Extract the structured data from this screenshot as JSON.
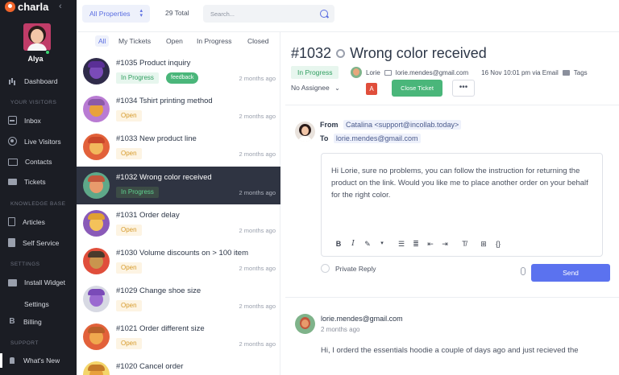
{
  "app": {
    "brand": "charla",
    "user_name": "Alya"
  },
  "sidebar": {
    "items": [
      {
        "label": "Dashboard",
        "icon": "bar-chart-icon"
      },
      {
        "label": "Inbox",
        "icon": "inbox-icon"
      },
      {
        "label": "Live Visitors",
        "icon": "live-visitors-icon"
      },
      {
        "label": "Contacts",
        "icon": "contacts-icon"
      },
      {
        "label": "Tickets",
        "icon": "ticket-icon"
      },
      {
        "label": "Articles",
        "icon": "article-icon"
      },
      {
        "label": "Self Service",
        "icon": "book-icon"
      },
      {
        "label": "Install Widget",
        "icon": "widget-icon"
      },
      {
        "label": "Settings",
        "icon": "settings-icon"
      },
      {
        "label": "Billing",
        "icon": "billing-icon"
      },
      {
        "label": "What's New",
        "icon": "megaphone-icon"
      }
    ],
    "sections": [
      "YOUR VISITORS",
      "KNOWLEDGE BASE",
      "SETTINGS",
      "SUPPORT"
    ]
  },
  "topbar": {
    "property_select": "All Properties",
    "total": "29 Total",
    "search_placeholder": "Search..."
  },
  "filters": [
    "All",
    "My Tickets",
    "Open",
    "In Progress",
    "Closed"
  ],
  "tickets": [
    {
      "title": "#1035 Product inquiry",
      "status": "In Progress",
      "tag": "feedback",
      "time": "2 months ago"
    },
    {
      "title": "#1034 Tshirt printing method",
      "status": "Open",
      "time": "2 months ago"
    },
    {
      "title": "#1033 New product line",
      "status": "Open",
      "time": "2 months ago"
    },
    {
      "title": "#1032 Wrong color received",
      "status": "In Progress",
      "time": "2 months ago"
    },
    {
      "title": "#1031 Order delay",
      "status": "Open",
      "time": "2 months ago"
    },
    {
      "title": "#1030 Volume discounts on > 100 item",
      "status": "Open",
      "time": "2 months ago"
    },
    {
      "title": "#1029 Change shoe size",
      "status": "Open",
      "time": "2 months ago"
    },
    {
      "title": "#1021 Order different size",
      "status": "Open",
      "time": "2 months ago"
    },
    {
      "title": "#1020 Cancel order",
      "status": "",
      "time": ""
    }
  ],
  "detail": {
    "number": "#1032",
    "title": "Wrong color received",
    "status": "In Progress",
    "contact_name": "Lorie",
    "contact_email": "lorie.mendes@gmail.com",
    "received": "16 Nov 10:01 pm via Email",
    "tags_label": "Tags",
    "assignee": "No Assignee",
    "assignee_badge": "A",
    "close_button": "Close Ticket",
    "more_button": "•••",
    "from_label": "From",
    "from_value": "Catalina <support@incollab.today>",
    "to_label": "To",
    "to_value": "lorie.mendes@gmail.com",
    "reply_text": "Hi Lorie, sure no problems, you can follow the instruction for returning the product on the link. Would you like me to place another order on your behalf for the right color.",
    "private_reply": "Private Reply",
    "send_button": "Send",
    "message_from": "lorie.mendes@gmail.com",
    "message_time": "2 months ago",
    "message_body": "Hi, I orderd the essentials hoodie a couple of days ago and just recieved the"
  },
  "colors": {
    "accent": "#5b72ef",
    "success": "#4ab67a",
    "sidebar": "#1b1d24",
    "warning": "#d69a2a"
  }
}
